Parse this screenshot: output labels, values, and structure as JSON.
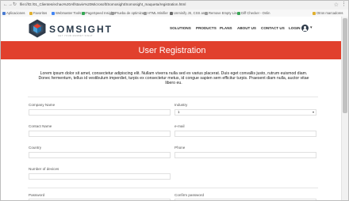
{
  "browser": {
    "url": "file:///D:/01_Clientes/echao%20Alfstaviv%20Microsoft/Somosight/Somosight_maqueta/registration.html",
    "bookmarks": [
      "Aplicaciones",
      "Favoritos",
      "Webmaster Tools: O",
      "PageSpeed Insights",
      "Prueba de optimiza",
      "HTML Minifier",
      "Unminify JS, CSS an",
      "Remove Empty Lines",
      "Diff Checker - Onlin",
      "Otros marcadores"
    ]
  },
  "site": {
    "logo_text": "SOMSIGHT",
    "logo_tagline": "GET YOUR MARKET SIGHT",
    "nav": [
      "SOLUTIONS",
      "PRODUCTS",
      "PLANS",
      "ABOUT US",
      "CONTACT US",
      "LOGIN"
    ]
  },
  "banner": {
    "title": "User Registration"
  },
  "intro": "Lorem ipsum dolor sit amet, consectetur adipiscing elit. Nullam viverra nulla sed ex varius placerat. Duis eget convallis justo, rutrum euismod diam. Donec fermentum, tellus id vestibulum imperdiet, turpis ex consectetur metus, id congue sapien sem efficitur turpis. Praesent diam nulla, auctor vitae libero eu.",
  "form": {
    "company_name": {
      "label": "Company Name",
      "value": ""
    },
    "industry": {
      "label": "Industry",
      "value": "1"
    },
    "contact_name": {
      "label": "Contact Name",
      "value": ""
    },
    "email": {
      "label": "e-mail",
      "value": ""
    },
    "country": {
      "label": "Country",
      "value": ""
    },
    "phone": {
      "label": "Phone",
      "value": ""
    },
    "num_devices": {
      "label": "Number of devices",
      "value": ""
    },
    "password": {
      "label": "Password",
      "value": ""
    },
    "confirm_password": {
      "label": "Confirm password",
      "value": ""
    }
  },
  "colors": {
    "brand_red": "#e1402d",
    "nav_dark": "#2f3b4a"
  }
}
